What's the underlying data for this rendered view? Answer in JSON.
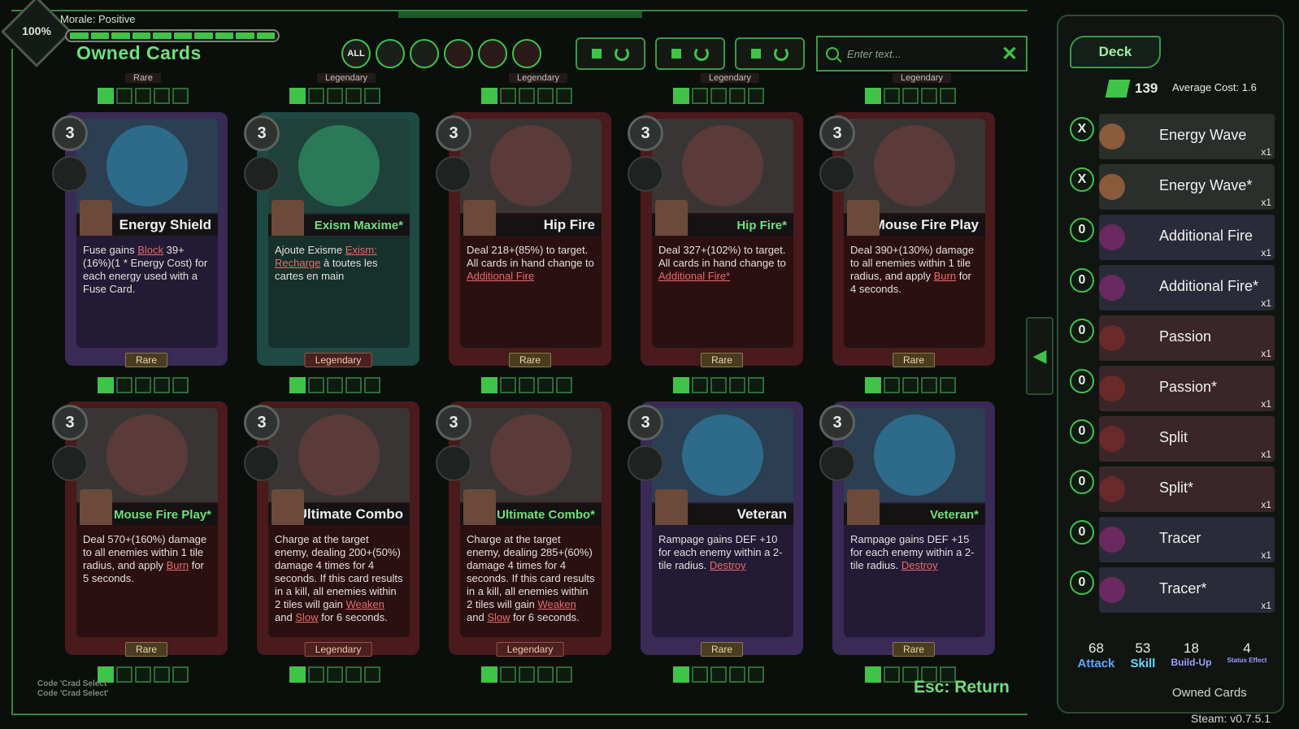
{
  "header": {
    "hud_percent": "100%",
    "morale_label": "Morale: Positive",
    "morale_level": 1.0,
    "title": "Owned Cards"
  },
  "filters": [
    {
      "label": "ALL",
      "icon": "all-filter-icon"
    },
    {
      "label": "",
      "icon": "chevron-down-filter-icon"
    },
    {
      "label": "",
      "icon": "no-filter-icon"
    },
    {
      "label": "",
      "icon": "character-red-portrait"
    },
    {
      "label": "",
      "icon": "character-blond-portrait"
    },
    {
      "label": "",
      "icon": "character-pink-portrait"
    }
  ],
  "search": {
    "placeholder": "Enter text..."
  },
  "top_row_labels": [
    "Rare",
    "Legendary",
    "Legendary",
    "Legendary",
    "Legendary"
  ],
  "cards": [
    {
      "cost": "3",
      "name": "Energy Shield",
      "rarity": "Rare",
      "theme": "purple",
      "desc": [
        "Fuse gains ",
        {
          "kw": "Block"
        },
        " 39+(16%)(1 * Energy Cost) for each energy used with a Fuse Card."
      ]
    },
    {
      "cost": "3",
      "name": "Exism Maxime*",
      "rarity": "Legendary",
      "theme": "teal",
      "green": true,
      "desc": [
        "Ajoute Exisme ",
        {
          "kw": "Exism: Recharge"
        },
        " à toutes les cartes en main"
      ]
    },
    {
      "cost": "3",
      "name": "Hip Fire",
      "rarity": "Rare",
      "theme": "red",
      "desc": [
        "Deal 218+(85%) to target. All cards in hand change to ",
        {
          "kw": "Additional Fire"
        }
      ]
    },
    {
      "cost": "3",
      "name": "Hip Fire*",
      "rarity": "Rare",
      "theme": "red",
      "green": true,
      "desc": [
        "Deal 327+(102%) to target. All cards in hand change to ",
        {
          "kw": "Additional Fire*"
        }
      ]
    },
    {
      "cost": "3",
      "name": "Mouse Fire Play",
      "rarity": "Rare",
      "theme": "red",
      "desc": [
        "Deal 390+(130%) damage to all enemies within 1 tile radius, and apply ",
        {
          "kw": "Burn"
        },
        " for 4 seconds."
      ]
    },
    {
      "cost": "3",
      "name": "Mouse Fire Play*",
      "rarity": "Rare",
      "theme": "red",
      "green": true,
      "desc": [
        "Deal 570+(160%) damage to all enemies within 1 tile radius, and apply ",
        {
          "kw": "Burn"
        },
        " for 5 seconds."
      ]
    },
    {
      "cost": "3",
      "name": "Ultimate Combo",
      "rarity": "Legendary",
      "theme": "red",
      "desc": [
        "Charge at the target enemy, dealing 200+(50%) damage 4 times for 4 seconds. If this card results in a kill, all enemies within 2 tiles will gain ",
        {
          "kw": "Weaken"
        },
        " and ",
        {
          "kw": "Slow"
        },
        " for 6 seconds."
      ]
    },
    {
      "cost": "3",
      "name": "Ultimate Combo*",
      "rarity": "Legendary",
      "theme": "red",
      "green": true,
      "desc": [
        "Charge at the target enemy, dealing 285+(60%) damage 4 times for 4 seconds. If this card results in a kill, all enemies within 2 tiles will gain ",
        {
          "kw": "Weaken"
        },
        " and ",
        {
          "kw": "Slow"
        },
        " for 6 seconds."
      ]
    },
    {
      "cost": "3",
      "name": "Veteran",
      "rarity": "Rare",
      "theme": "purple",
      "desc": [
        "Rampage gains DEF +10 for each enemy within a 2-tile radius. ",
        {
          "kw": "Destroy"
        }
      ]
    },
    {
      "cost": "3",
      "name": "Veteran*",
      "rarity": "Rare",
      "theme": "purple",
      "green": true,
      "desc": [
        "Rampage gains DEF +15 for each enemy within a 2-tile radius. ",
        {
          "kw": "Destroy"
        }
      ]
    }
  ],
  "deck": {
    "tab_label": "Deck",
    "count": "139",
    "average_cost": "Average Cost: 1.6",
    "items": [
      {
        "cost": "X",
        "name": "Energy Wave",
        "qty": "x1",
        "theme": "blond"
      },
      {
        "cost": "X",
        "name": "Energy Wave*",
        "qty": "x1",
        "theme": "blond"
      },
      {
        "cost": "0",
        "name": "Additional Fire",
        "qty": "x1",
        "theme": "pink"
      },
      {
        "cost": "0",
        "name": "Additional Fire*",
        "qty": "x1",
        "theme": "pink"
      },
      {
        "cost": "0",
        "name": "Passion",
        "qty": "x1",
        "theme": "red"
      },
      {
        "cost": "0",
        "name": "Passion*",
        "qty": "x1",
        "theme": "red"
      },
      {
        "cost": "0",
        "name": "Split",
        "qty": "x1",
        "theme": "red"
      },
      {
        "cost": "0",
        "name": "Split*",
        "qty": "x1",
        "theme": "red"
      },
      {
        "cost": "0",
        "name": "Tracer",
        "qty": "x1",
        "theme": "pink"
      },
      {
        "cost": "0",
        "name": "Tracer*",
        "qty": "x1",
        "theme": "pink"
      }
    ],
    "stats": [
      {
        "num": "68",
        "label": "Attack",
        "kind": "attack"
      },
      {
        "num": "53",
        "label": "Skill",
        "kind": "skill"
      },
      {
        "num": "18",
        "label": "Build-Up",
        "kind": "buildup"
      },
      {
        "num": "4",
        "label": "Status Effect",
        "kind": "status"
      }
    ],
    "footer": "Owned Cards"
  },
  "esc_hint": "Esc: Return",
  "code_lines": [
    "Code 'Crad Select'",
    "Code 'Crad Select'"
  ],
  "version": "Steam: v0.7.5.1"
}
